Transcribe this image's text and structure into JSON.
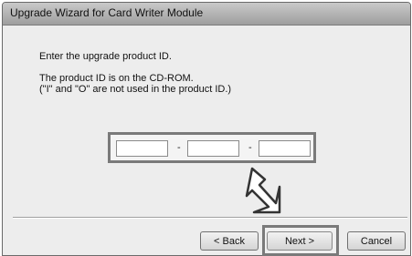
{
  "window": {
    "title": "Upgrade Wizard for Card Writer Module"
  },
  "instructions": {
    "line1": "Enter the upgrade product ID.",
    "line2": "The product ID is on the CD-ROM.",
    "line3": "(\"I\" and \"O\" are not used in the product ID.)"
  },
  "product_id": {
    "fields": [
      {
        "value": ""
      },
      {
        "value": ""
      },
      {
        "value": ""
      }
    ],
    "separator": "-"
  },
  "buttons": {
    "back": "< Back",
    "next": "Next >",
    "cancel": "Cancel"
  },
  "icons": {
    "pointer": "down-right-arrow-icon"
  }
}
